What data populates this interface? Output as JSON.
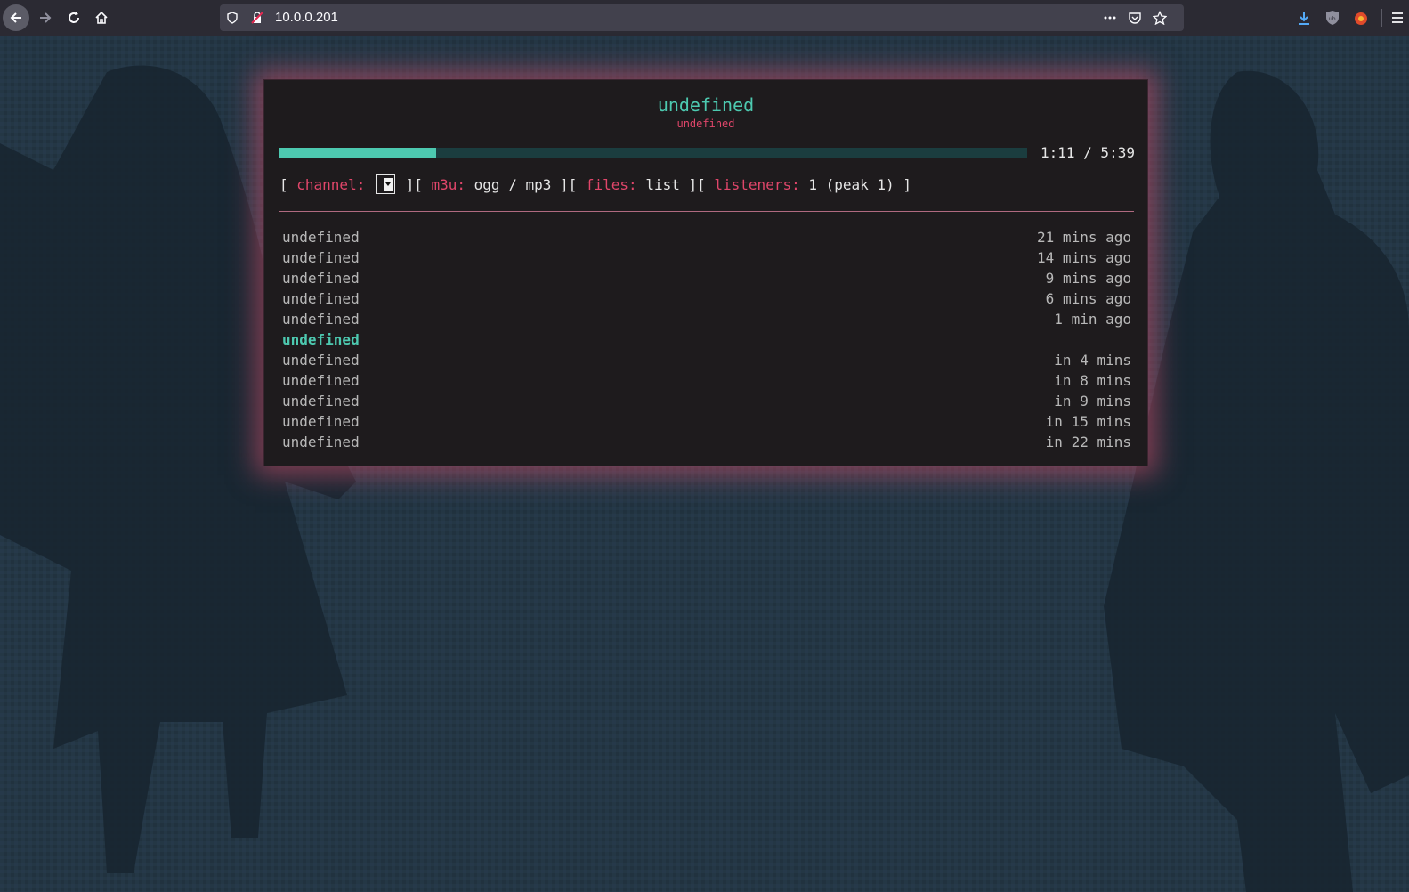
{
  "browser": {
    "url": "10.0.0.201"
  },
  "player": {
    "title": "undefined",
    "subtitle": "undefined",
    "progress_fraction": 0.21,
    "time": "1:11 / 5:39",
    "info": {
      "open1": "[ ",
      "channel_label": "channel:",
      "sep1": " ][ ",
      "m3u_label": "m3u:",
      "m3u_value": " ogg / mp3",
      "sep2": " ][ ",
      "files_label": "files:",
      "files_value": " list",
      "sep3": " ][ ",
      "listeners_label": "listeners:",
      "listeners_value": " 1 (peak 1)",
      "close": " ]"
    },
    "tracks": [
      {
        "title": "undefined",
        "when": "21 mins ago"
      },
      {
        "title": "undefined",
        "when": "14 mins ago"
      },
      {
        "title": "undefined",
        "when": "9 mins ago"
      },
      {
        "title": "undefined",
        "when": "6 mins ago"
      },
      {
        "title": "undefined",
        "when": "1 min ago"
      },
      {
        "title": "undefined",
        "when": "",
        "current": true
      },
      {
        "title": "undefined",
        "when": "in 4 mins"
      },
      {
        "title": "undefined",
        "when": "in 8 mins"
      },
      {
        "title": "undefined",
        "when": "in 9 mins"
      },
      {
        "title": "undefined",
        "when": "in 15 mins"
      },
      {
        "title": "undefined",
        "when": "in 22 mins"
      }
    ]
  },
  "colors": {
    "accent_teal": "#4dc9b0",
    "accent_pink": "#e0466a",
    "panel_bg": "#1e1b1d",
    "page_bg": "#223440"
  }
}
